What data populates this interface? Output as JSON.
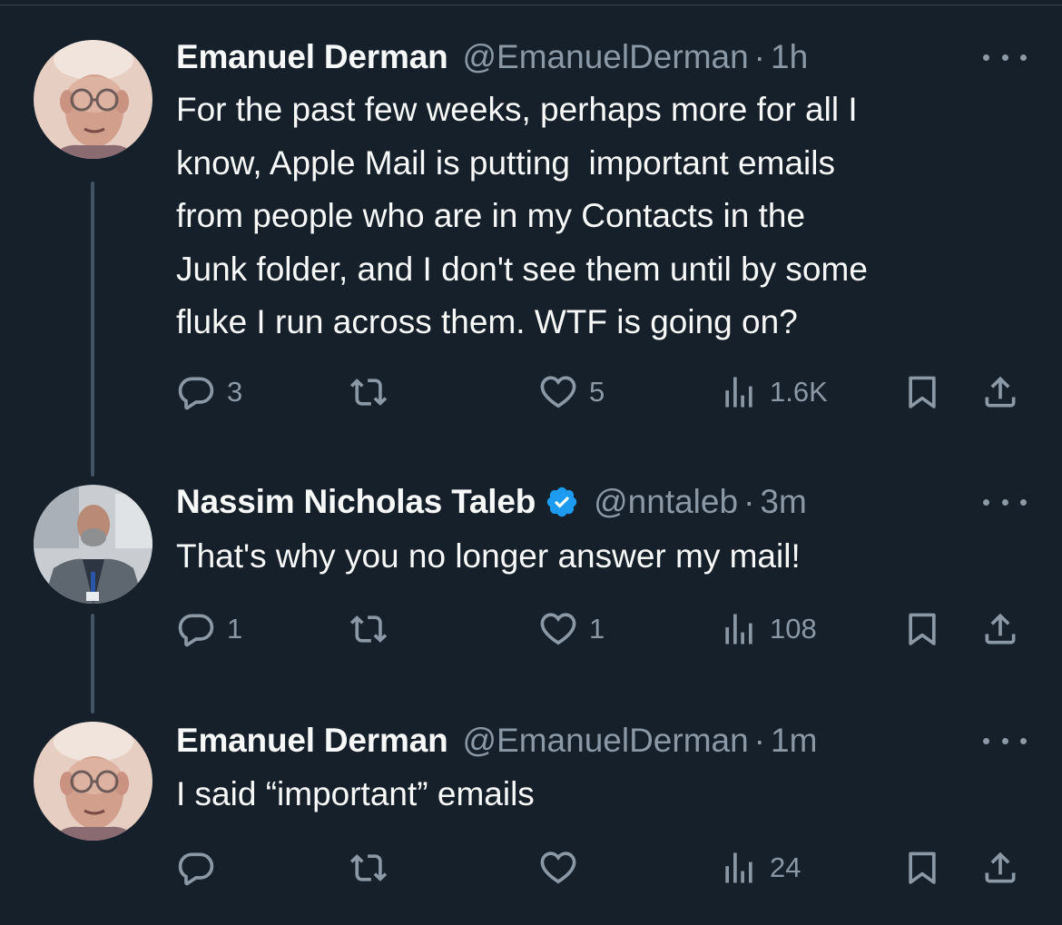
{
  "thread": [
    {
      "author_name": "Emanuel Derman",
      "handle": "@EmanuelDerman",
      "separator": "·",
      "time": "1h",
      "verified": false,
      "text": "For the past few weeks, perhaps more for all I know, Apple Mail is putting  important emails from people who are in my Contacts in the Junk folder, and I don't see them until by some fluke I run across them. WTF is going on?",
      "lines": [
        "For the past few weeks, perhaps more for all I",
        "know, Apple Mail is putting  important emails",
        "from people who are in my Contacts in the",
        "Junk folder, and I don't see them until by some",
        "fluke I run across them. WTF is going on?"
      ],
      "replies": "3",
      "reposts": "",
      "likes": "5",
      "views": "1.6K"
    },
    {
      "author_name": "Nassim Nicholas Taleb",
      "handle": "@nntaleb",
      "separator": "·",
      "time": "3m",
      "verified": true,
      "lines": [
        "That's why you no longer answer my mail!"
      ],
      "replies": "1",
      "reposts": "",
      "likes": "1",
      "views": "108"
    },
    {
      "author_name": "Emanuel Derman",
      "handle": "@EmanuelDerman",
      "separator": "·",
      "time": "1m",
      "verified": false,
      "lines": [
        "I said “important” emails"
      ],
      "replies": "",
      "reposts": "",
      "likes": "",
      "views": "24"
    }
  ],
  "icons": {
    "reply": "reply-icon",
    "repost": "repost-icon",
    "like": "like-icon",
    "views": "views-icon",
    "bookmark": "bookmark-icon",
    "share": "share-icon",
    "more": "more-icon",
    "verified": "verified-badge-icon"
  },
  "colors": {
    "background": "#15202b",
    "text": "#f7f9f9",
    "secondary": "#8b98a5",
    "thread_line": "#425364",
    "verified": "#1d9bf0"
  }
}
